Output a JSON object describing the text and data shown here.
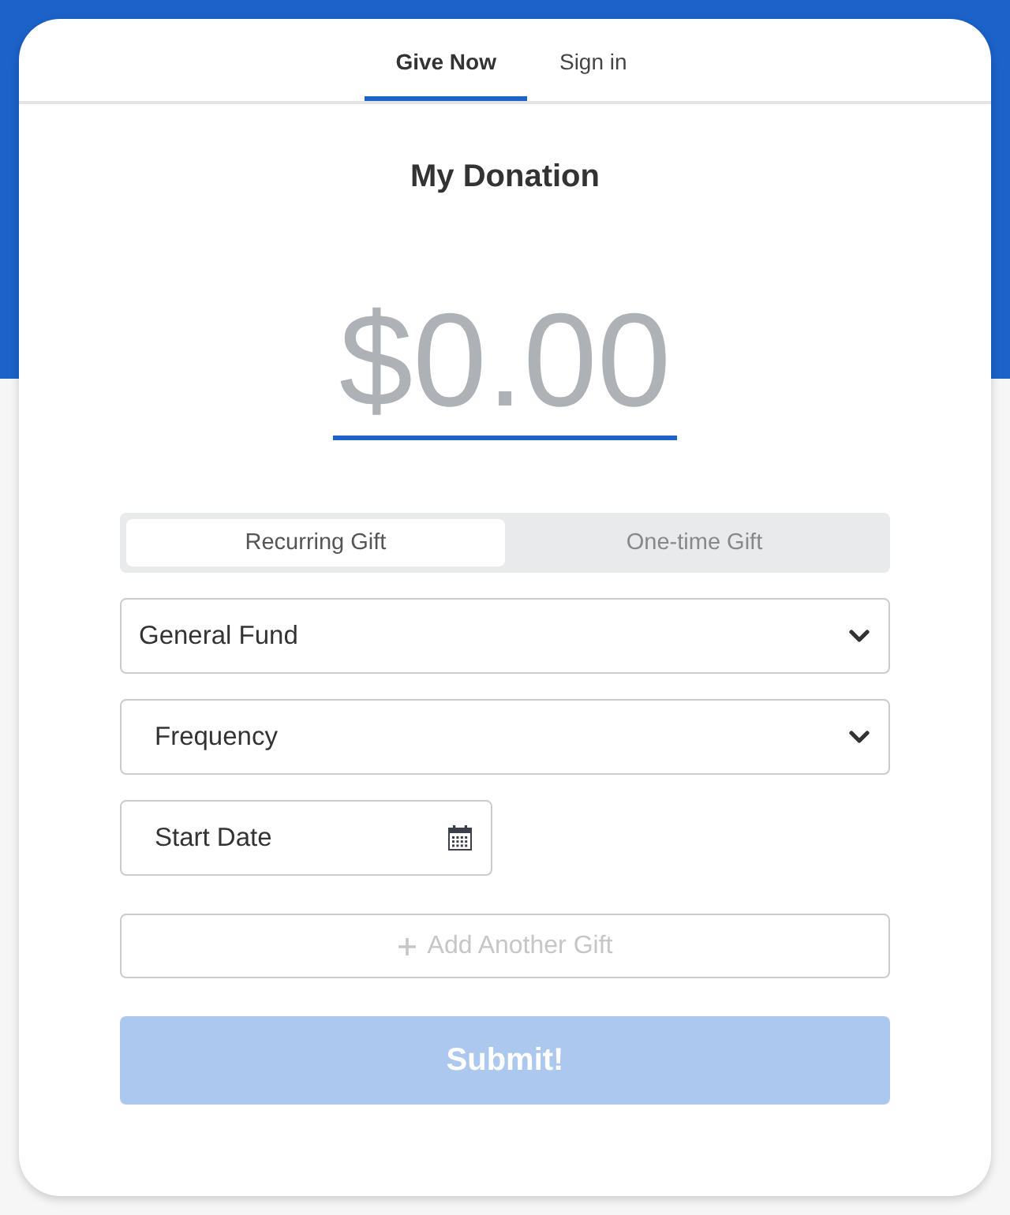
{
  "tabs": [
    {
      "label": "Give Now",
      "selected": true
    },
    {
      "label": "Sign in",
      "selected": false
    }
  ],
  "heading": "My Donation",
  "amount": {
    "value": "$0.00"
  },
  "gift_type": [
    {
      "label": "Recurring Gift",
      "selected": true
    },
    {
      "label": "One-time Gift",
      "selected": false
    }
  ],
  "fund_select": {
    "value": "General Fund"
  },
  "frequency_select": {
    "placeholder": "Frequency"
  },
  "start_date": {
    "placeholder": "Start Date"
  },
  "add_gift_button": {
    "label": "Add Another Gift",
    "disabled": true
  },
  "submit_button": {
    "label": "Submit!",
    "disabled": true
  }
}
